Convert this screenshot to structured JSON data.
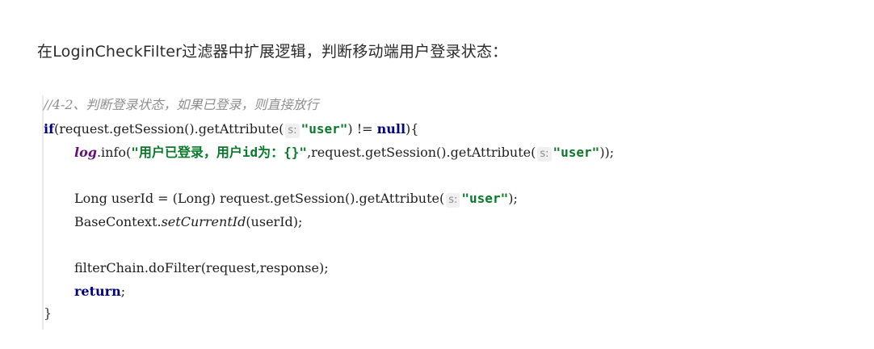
{
  "heading": "在LoginCheckFilter过滤器中扩展逻辑，判断移动端用户登录状态：",
  "code": {
    "comment": "//4-2、判断登录状态，如果已登录，则直接放行",
    "if_kw": "if",
    "if_call": "(request.getSession().getAttribute(",
    "hint_s": "s:",
    "str_user": "\"user\"",
    "if_tail": ") != ",
    "null_kw": "null",
    "if_close": "){",
    "log_field": "log",
    "log_call": ".info(",
    "log_str": "\"用户已登录，用户id为：{}\"",
    "log_mid": ",request.getSession().getAttribute(",
    "log_end": "));",
    "decl_start": "Long userId = (Long) request.getSession().getAttribute(",
    "decl_end": ");",
    "ctx_prefix": "BaseContext.",
    "ctx_method": "setCurrentId",
    "ctx_args": "(userId);",
    "filter_line": "filterChain.doFilter(request,response);",
    "return_kw": "return",
    "return_semi": ";",
    "close_brace": "}"
  }
}
